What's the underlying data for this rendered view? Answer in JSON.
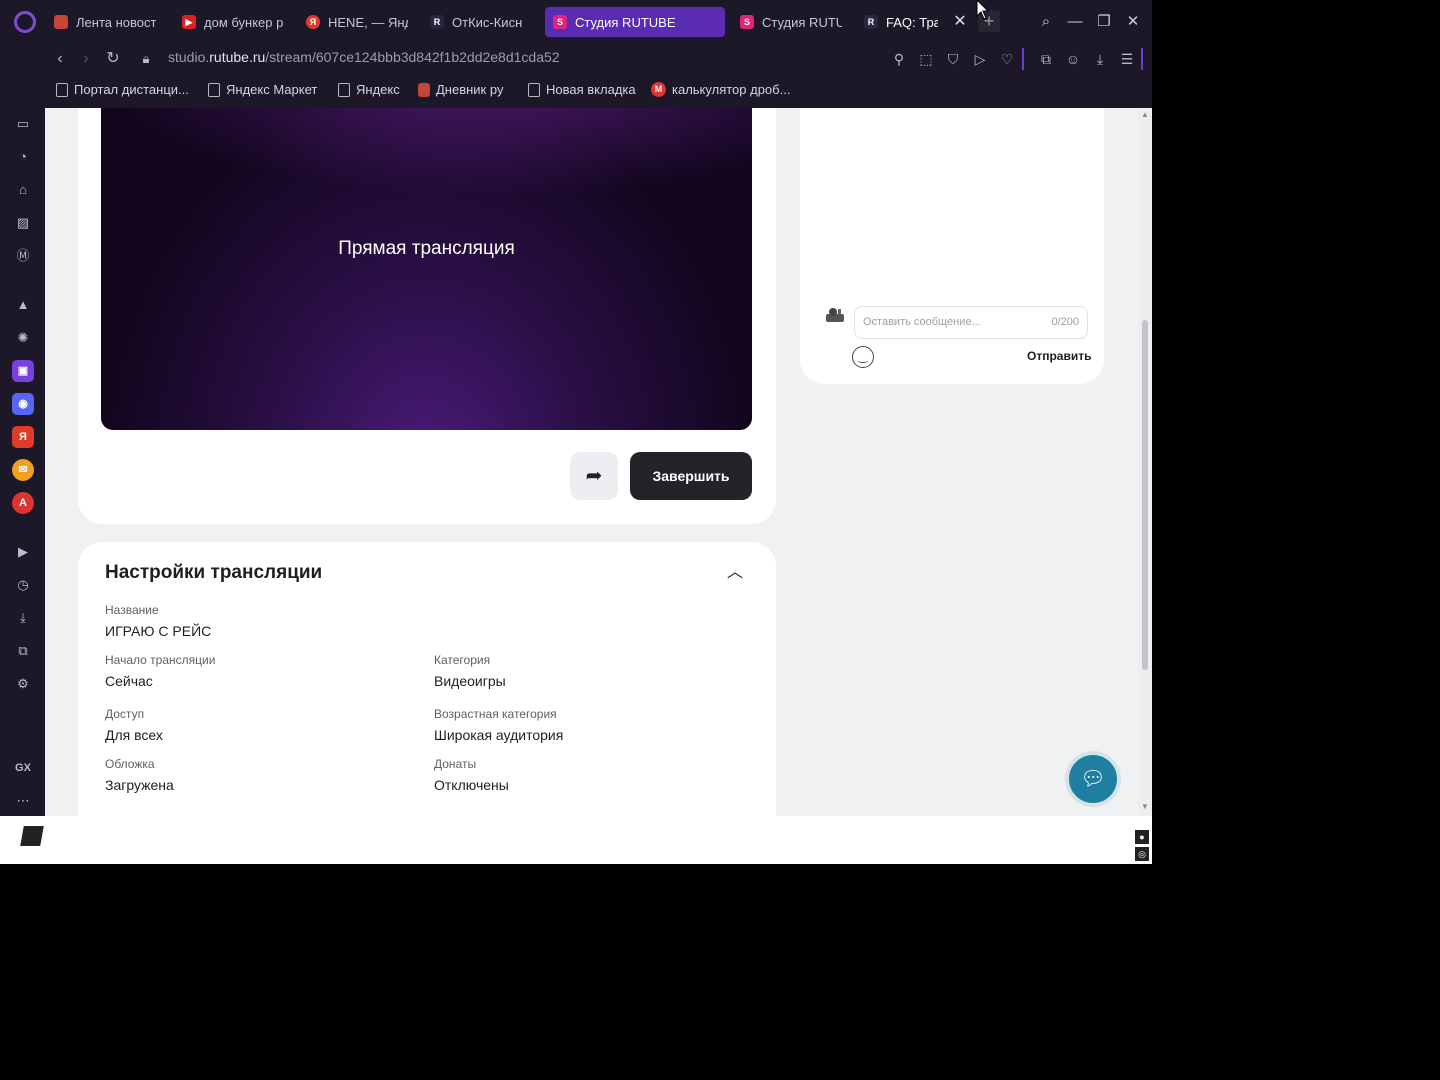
{
  "browser": {
    "tabs": [
      {
        "label": "Лента новост",
        "favicon": "crest-icon",
        "color": "#c4463a"
      },
      {
        "label": "дом бункер р",
        "favicon": "youtube-icon",
        "color": "#e02020"
      },
      {
        "label": "HENE, — Янд",
        "favicon": "yandex-icon",
        "color": "#e23a2a"
      },
      {
        "label": "ОтКис-Кисн",
        "favicon": "rutube-icon",
        "color": "#1e1b2e"
      },
      {
        "label": "Студия RUTUBE",
        "favicon": "studio-icon",
        "color": "#e0267a"
      },
      {
        "label": "Студия RUTU",
        "favicon": "studio-icon",
        "color": "#e0267a"
      },
      {
        "label": "FAQ: Тра",
        "favicon": "rutube-icon",
        "color": "#1e1b2e"
      }
    ],
    "url_prefix": "studio.",
    "url_host": "rutube.ru",
    "url_path": "/stream/607ce124bbb3d842f1b2dd2e8d1cda52",
    "bookmarks": [
      {
        "label": "Портал дистанци..."
      },
      {
        "label": "Яндекс Маркет"
      },
      {
        "label": "Яндекс"
      },
      {
        "label": "Дневник ру"
      },
      {
        "label": "Новая вкладка"
      },
      {
        "label": "калькулятор дроб..."
      }
    ],
    "sidebar_gx_label": "GX",
    "accent": "#5a2bb3"
  },
  "player": {
    "title": "Прямая трансляция",
    "finish_label": "Завершить"
  },
  "chat": {
    "placeholder": "Оставить сообщение...",
    "counter": "0/200",
    "send_label": "Отправить"
  },
  "settings": {
    "title": "Настройки трансляции",
    "fields": {
      "name": {
        "label": "Название",
        "value": "ИГРАЮ С РЕЙС"
      },
      "start": {
        "label": "Начало трансляции",
        "value": "Сейчас"
      },
      "category": {
        "label": "Категория",
        "value": "Видеоигры"
      },
      "access": {
        "label": "Доступ",
        "value": "Для всех"
      },
      "age": {
        "label": "Возрастная категория",
        "value": "Широкая аудитория"
      },
      "cover": {
        "label": "Обложка",
        "value": "Загружена"
      },
      "donations": {
        "label": "Донаты",
        "value": "Отключены"
      }
    }
  }
}
